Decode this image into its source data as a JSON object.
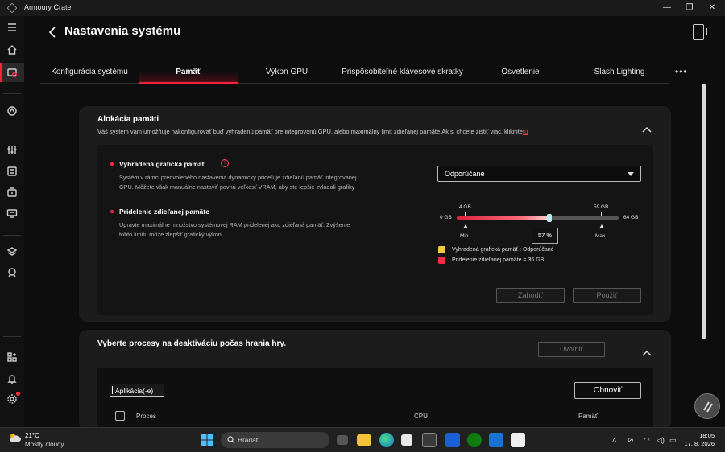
{
  "window": {
    "title": "Armoury Crate"
  },
  "header": {
    "title": "Nastavenia systému"
  },
  "tabs": [
    {
      "label": "Konfigurácia systému"
    },
    {
      "label": "Pamäť"
    },
    {
      "label": "Výkon GPU"
    },
    {
      "label": "Prispôsobiteľné klávesové skratky"
    },
    {
      "label": "Osvetlenie"
    },
    {
      "label": "Slash Lighting"
    }
  ],
  "more_label": "•••",
  "memory_panel": {
    "title": "Alokácia pamäti",
    "description": "Váš systém vám umožňuje nakonfigurovať buď vyhradenú pamäť pre integrovanú GPU, alebo maximálny limit zdieľanej pamäte.Ak si chcete zistiť viac, kliknite",
    "link": "tu",
    "dedicated": {
      "title": "Vyhradená grafická pamäť",
      "info": "!",
      "desc_line1": "Systém v rámci predvoleného nastavenia dynamicky prideľuje zdieľanú pamäť integrovanej",
      "desc_line2": "GPU. Môžete však manuálne nastaviť pevnú veľkosť VRAM, aby ste lepšie zvládali grafiky"
    },
    "shared": {
      "title": "Pridelenie zdieľanej pamäte",
      "desc_line1": "Upravte maximálne množstvo systémovej RAM pridelenej ako zdieľaná pamäť. Zvýšenie",
      "desc_line2": "tohto limitu môže zlepšiť grafický výkon."
    },
    "dropdown": {
      "value": "Odporúčané"
    },
    "slider": {
      "min_label": "0 GB",
      "max_label": "64 GB",
      "low_mark": "4 GB",
      "high_mark": "59 GB",
      "low_caption": "Min",
      "high_caption": "Max",
      "value_percent": 57,
      "value_label": "57 %"
    },
    "legend": [
      {
        "label": "Vyhradená grafická pamäť : Odporúčané",
        "color": "#f5c842"
      },
      {
        "label": "Pridelenie zdieľanej pamäte = 36 GB",
        "color": "#ff2a44"
      }
    ],
    "cancel_label": "Zahodiť",
    "apply_label": "Použiť"
  },
  "process_panel": {
    "title": "Vyberte procesy na deaktiváciu počas hrania hry.",
    "release_label": "Uvoľniť",
    "search_value": "Aplikácia(-e)",
    "refresh_label": "Obnoviť",
    "columns": [
      "Proces",
      "CPU",
      "Pamäť"
    ]
  },
  "taskbar": {
    "temp": "21°C",
    "weather": "Mostly cloudy",
    "search_placeholder": "Hľadať",
    "time": "18:05",
    "date": "17. 8. 2026"
  }
}
